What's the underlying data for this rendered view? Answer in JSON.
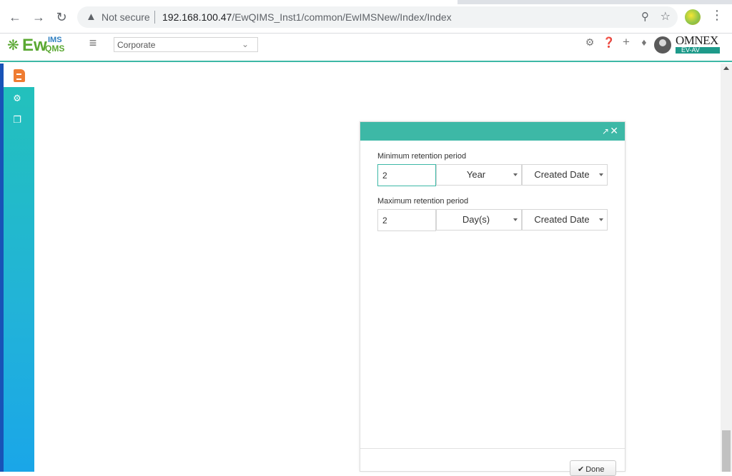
{
  "browser": {
    "security_label": "Not secure",
    "url_host": "192.168.100.47",
    "url_path": "/EwQIMS_Inst1/common/EwIMSNew/Index/Index",
    "icons": [
      "back-arrow-icon",
      "forward-arrow-icon",
      "reload-icon",
      "warning-icon",
      "zoom-icon",
      "bookmark-star-icon",
      "profile-avatar-icon",
      "more-menu-icon"
    ]
  },
  "header": {
    "logo": {
      "ew": "Ew",
      "ims": "IMS",
      "qms": "QMS"
    },
    "corporate_select": "Corporate",
    "brand": {
      "name": "OMNEX",
      "sub": "EV-AV"
    },
    "icons": [
      "gear-icon",
      "help-icon",
      "plus-icon",
      "bell-icon",
      "user-avatar-icon"
    ],
    "accent_color": "#3db8a6"
  },
  "sidebar": {
    "items": [
      {
        "icon": "document-icon",
        "active": true
      },
      {
        "icon": "settings-cogs-icon",
        "active": false
      },
      {
        "icon": "copy-icon",
        "active": false
      }
    ]
  },
  "dialog": {
    "min_label": "Minimum retention period",
    "min_value": "2",
    "min_unit": "Year",
    "min_basis": "Created Date",
    "max_label": "Maximum retention period",
    "max_value": "2",
    "max_unit": "Day(s)",
    "max_basis": "Created Date",
    "done_label": "Done",
    "icons": [
      "external-link-icon",
      "close-icon",
      "checkmark-icon"
    ]
  }
}
